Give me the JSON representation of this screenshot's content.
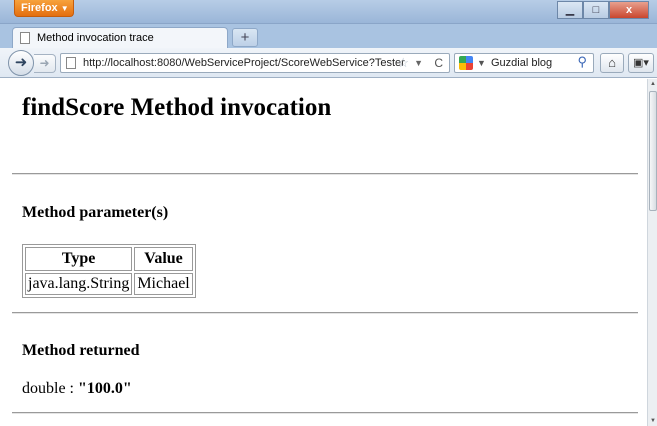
{
  "browser": {
    "menu_button": "Firefox",
    "tab_title": "Method invocation trace",
    "new_tab": "+",
    "url": "http://localhost:8080/WebServiceProject/ScoreWebService?Tester",
    "search_engine_text": "Guzdial blog"
  },
  "page": {
    "heading": "findScore Method invocation",
    "params_heading": "Method parameter(s)",
    "params_table": {
      "headers": [
        "Type",
        "Value"
      ],
      "rows": [
        [
          "java.lang.String",
          "Michael"
        ]
      ]
    },
    "returned_heading": "Method returned",
    "returned_type": "double : ",
    "returned_value": "\"100.0\""
  }
}
